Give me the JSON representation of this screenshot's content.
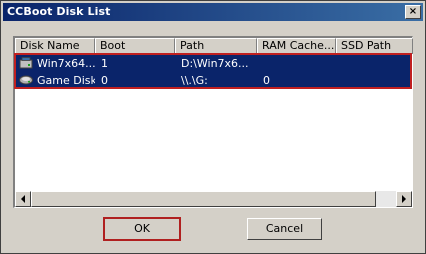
{
  "window": {
    "title": "CCBoot Disk List",
    "close_label": "×"
  },
  "list": {
    "columns": [
      "Disk Name",
      "Boot",
      "Path",
      "RAM Cache...",
      "SSD Path"
    ],
    "rows": [
      {
        "icon": "system-disk-icon",
        "cells": [
          "Win7x64...",
          "1",
          "D:\\Win7x6...",
          "",
          ""
        ]
      },
      {
        "icon": "game-disk-icon",
        "cells": [
          "Game Disk",
          "0",
          "\\\\.\\G:",
          "0",
          ""
        ]
      }
    ],
    "selection_color": "#0a246a"
  },
  "buttons": {
    "ok_label": "OK",
    "cancel_label": "Cancel"
  }
}
